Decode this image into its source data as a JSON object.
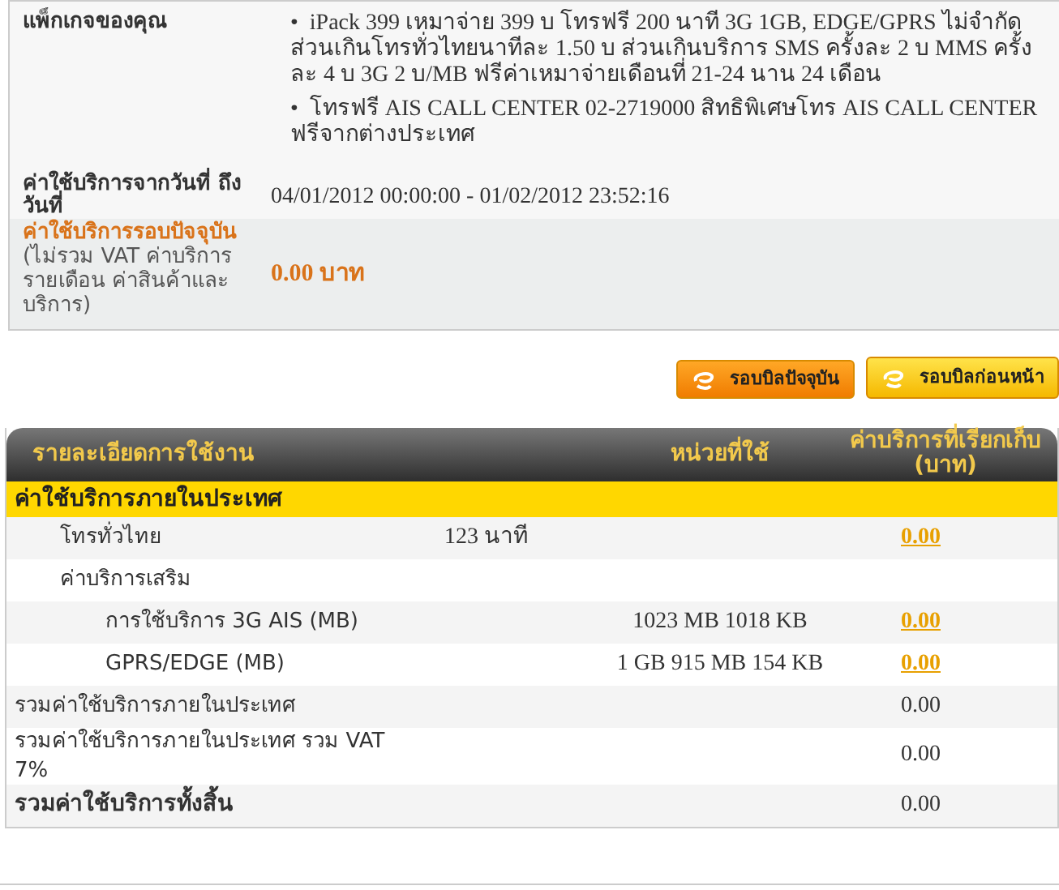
{
  "summary": {
    "package": {
      "label": "แพ็กเกจของคุณ",
      "items": [
        {
          "bullet": "•",
          "text": "iPack 399 เหมาจ่าย 399 บ โทรฟรี 200 นาที 3G 1GB, EDGE/GPRS ไม่จำกัด ส่วนเกินโทรทั่วไทยนาทีละ 1.50 บ ส่วนเกินบริการ SMS ครั้งละ 2 บ MMS ครั้งละ 4 บ 3G 2 บ/MB ฟรีค่าเหมาจ่ายเดือนที่ 21-24 นาน 24 เดือน"
        },
        {
          "bullet": "•",
          "text": "โทรฟรี AIS CALL CENTER 02-2719000 สิทธิพิเศษโทร AIS CALL CENTER ฟรีจากต่างประเทศ"
        }
      ]
    },
    "period": {
      "label": "ค่าใช้บริการจากวันที่ ถึง วันที่",
      "value": "04/01/2012 00:00:00 - 01/02/2012 23:52:16"
    },
    "current": {
      "label": "ค่าใช้บริการรอบปัจจุบัน",
      "note": "(ไม่รวม VAT ค่าบริการรายเดือน ค่าสินค้าและบริการ)",
      "value": "0.00 บาท"
    }
  },
  "bill_buttons": [
    {
      "label": "รอบบิลปัจจุบัน",
      "selected": true
    },
    {
      "label": "รอบบิลก่อนหน้า",
      "selected": false
    }
  ],
  "table": {
    "columns": [
      "รายละเอียดการใช้งาน",
      "หน่วยที่ใช้",
      "ค่าบริการที่เรียกเก็บ (บาท)"
    ],
    "section": "ค่าใช้บริการภายในประเทศ",
    "rows": [
      {
        "label": "โทรทั่วไทย",
        "duration": "123 นาที",
        "charge": "0.00",
        "link": true
      },
      {
        "label": "ค่าบริการเสริม",
        "children": [
          {
            "label": "การใช้บริการ 3G AIS (MB)",
            "usage": "1023 MB 1018 KB",
            "charge": "0.00",
            "link": true
          },
          {
            "label": "GPRS/EDGE (MB)",
            "usage": "1 GB 915 MB 154 KB",
            "charge": "0.00",
            "link": true
          }
        ]
      }
    ],
    "totals": [
      {
        "kind": "total",
        "label": "รวมค่าใช้บริการภายในประเทศ",
        "charge": "0.00"
      },
      {
        "kind": "total",
        "label": "รวมค่าใช้บริการภายในประเทศ รวม VAT 7%",
        "charge": "0.00"
      },
      {
        "kind": "grand_total",
        "label": "รวมค่าใช้บริการทั้งสิ้น",
        "charge": "0.00"
      }
    ]
  }
}
